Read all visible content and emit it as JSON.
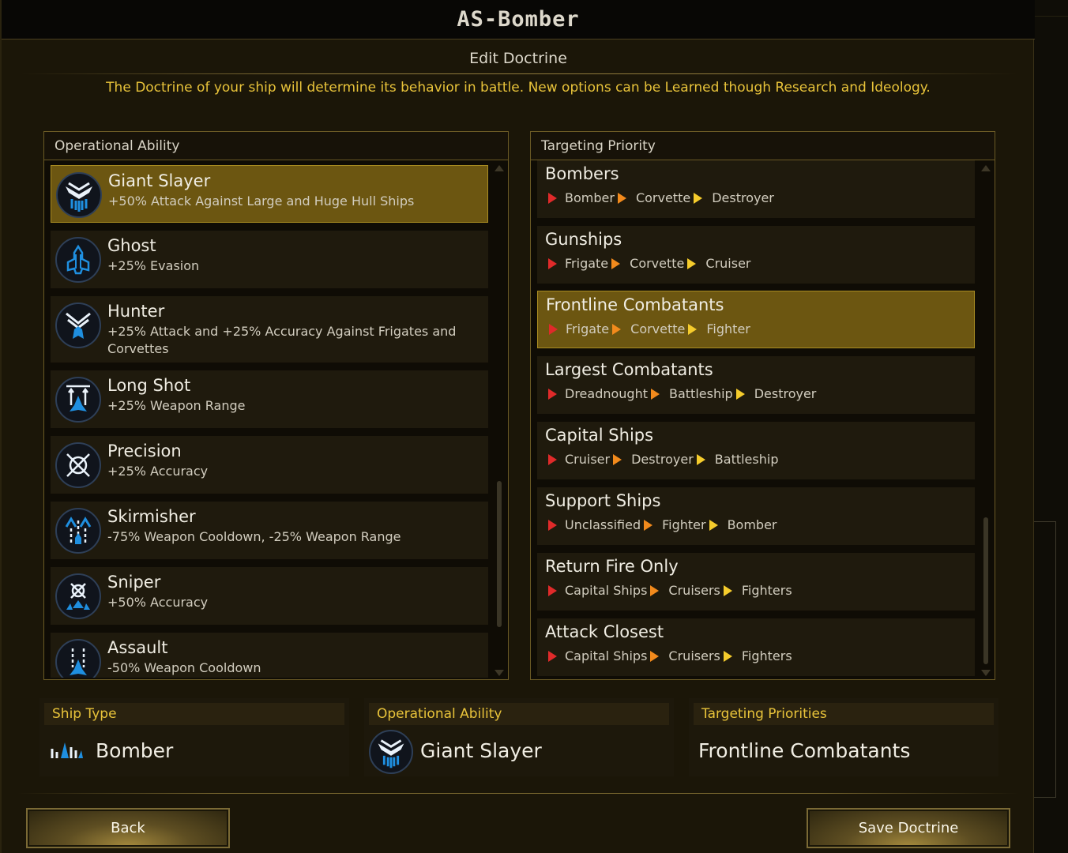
{
  "window": {
    "title": "AS-Bomber",
    "subtitle": "Edit Doctrine",
    "description": "The Doctrine of your ship will determine its behavior in battle. New options can be Learned though Research and Ideology."
  },
  "operational_ability": {
    "header": "Operational Ability",
    "items": [
      {
        "name": "Giant Slayer",
        "desc": "+50% Attack Against Large and Huge Hull Ships",
        "icon": "giant-slayer-icon",
        "selected": true
      },
      {
        "name": "Ghost",
        "desc": "+25% Evasion",
        "icon": "ghost-icon",
        "selected": false
      },
      {
        "name": "Hunter",
        "desc": "+25% Attack and +25% Accuracy Against Frigates and Corvettes",
        "icon": "hunter-icon",
        "selected": false
      },
      {
        "name": "Long Shot",
        "desc": "+25% Weapon Range",
        "icon": "long-shot-icon",
        "selected": false
      },
      {
        "name": "Precision",
        "desc": "+25% Accuracy",
        "icon": "precision-icon",
        "selected": false
      },
      {
        "name": "Skirmisher",
        "desc": "-75% Weapon Cooldown, -25% Weapon Range",
        "icon": "skirmisher-icon",
        "selected": false
      },
      {
        "name": "Sniper",
        "desc": "+50% Accuracy",
        "icon": "sniper-icon",
        "selected": false
      },
      {
        "name": "Assault",
        "desc": "-50% Weapon Cooldown",
        "icon": "assault-icon",
        "selected": false
      }
    ]
  },
  "targeting_priority": {
    "header": "Targeting Priority",
    "items": [
      {
        "name": "Bombers",
        "chain": [
          "Bomber",
          "Corvette",
          "Destroyer"
        ],
        "selected": false
      },
      {
        "name": "Gunships",
        "chain": [
          "Frigate",
          "Corvette",
          "Cruiser"
        ],
        "selected": false
      },
      {
        "name": "Frontline Combatants",
        "chain": [
          "Frigate",
          "Corvette",
          "Fighter"
        ],
        "selected": true
      },
      {
        "name": "Largest Combatants",
        "chain": [
          "Dreadnought",
          "Battleship",
          "Destroyer"
        ],
        "selected": false
      },
      {
        "name": "Capital Ships",
        "chain": [
          "Cruiser",
          "Destroyer",
          "Battleship"
        ],
        "selected": false
      },
      {
        "name": "Support Ships",
        "chain": [
          "Unclassified",
          "Fighter",
          "Bomber"
        ],
        "selected": false
      },
      {
        "name": "Return Fire Only",
        "chain": [
          "Capital Ships",
          "Cruisers",
          "Fighters"
        ],
        "selected": false
      },
      {
        "name": "Attack Closest",
        "chain": [
          "Capital Ships",
          "Cruisers",
          "Fighters"
        ],
        "selected": false
      }
    ]
  },
  "summary": {
    "ship_type": {
      "header": "Ship Type",
      "value": "Bomber",
      "icon": "bomber-class-icon"
    },
    "operational_ability": {
      "header": "Operational Ability",
      "value": "Giant Slayer",
      "icon": "giant-slayer-icon"
    },
    "targeting_priorities": {
      "header": "Targeting Priorities",
      "value": "Frontline Combatants"
    }
  },
  "buttons": {
    "back": "Back",
    "save": "Save Doctrine"
  },
  "colors": {
    "accent": "#e8c33a",
    "selected": "#6c5611",
    "priority_1": "#e02a2a",
    "priority_2": "#f28a1c",
    "priority_3": "#f5cc2c",
    "icon_blue": "#1f8fe0"
  }
}
